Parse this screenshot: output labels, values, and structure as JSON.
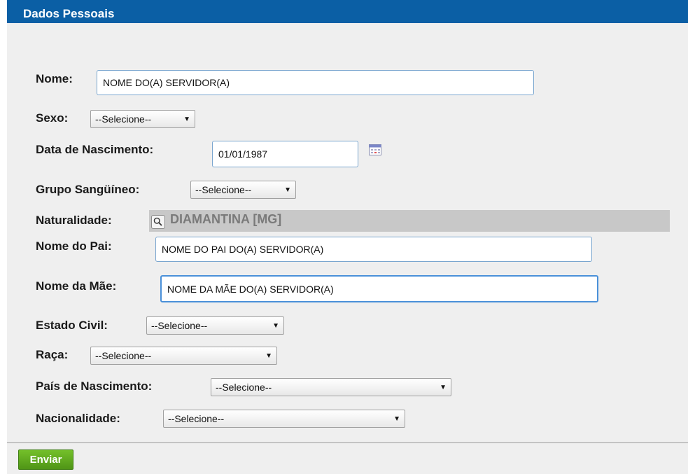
{
  "header": {
    "title": "Dados Pessoais"
  },
  "form": {
    "nome": {
      "label": "Nome:",
      "value": "NOME DO(A) SERVIDOR(A)"
    },
    "sexo": {
      "label": "Sexo:",
      "selected": "--Selecione--"
    },
    "data_nascimento": {
      "label": "Data de Nascimento:",
      "value": "01/01/1987"
    },
    "grupo_sanguineo": {
      "label": "Grupo Sangüíneo:",
      "selected": "--Selecione--"
    },
    "naturalidade": {
      "label": "Naturalidade:",
      "value": "DIAMANTINA [MG]"
    },
    "nome_pai": {
      "label": "Nome do Pai:",
      "value": "NOME DO PAI  DO(A) SERVIDOR(A)"
    },
    "nome_mae": {
      "label": "Nome da Mãe:",
      "value": "NOME DA MÃE DO(A) SERVIDOR(A)"
    },
    "estado_civil": {
      "label": "Estado Civil:",
      "selected": "--Selecione--"
    },
    "raca": {
      "label": "Raça:",
      "selected": "--Selecione--"
    },
    "pais_nascimento": {
      "label": "País de Nascimento:",
      "selected": "--Selecione--"
    },
    "nacionalidade": {
      "label": "Nacionalidade:",
      "selected": "--Selecione--"
    }
  },
  "actions": {
    "submit_label": "Enviar"
  },
  "icons": {
    "calendar": "calendar-icon",
    "search": "magnifier-icon",
    "dropdown": "chevron-down-icon"
  },
  "colors": {
    "header_bg": "#0b5fa5",
    "focus_border": "#4a90d9",
    "submit_bg": "#5ea51e"
  }
}
